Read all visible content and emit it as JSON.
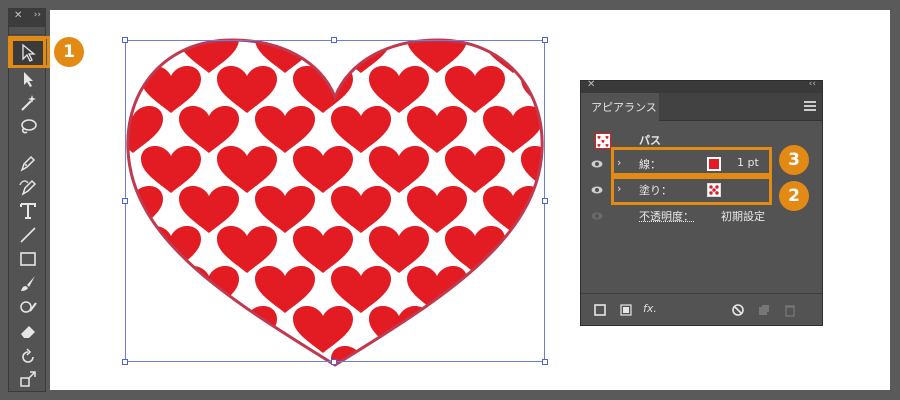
{
  "tools_panel": {
    "close_glyph": "✕",
    "collapse_glyph": "››",
    "tools": [
      {
        "name": "selection-tool",
        "icon": "selection-arrow-icon"
      },
      {
        "name": "direct-selection-tool",
        "icon": "direct-selection-arrow-icon"
      },
      {
        "name": "magic-wand-tool",
        "icon": "magic-wand-icon"
      },
      {
        "name": "lasso-tool",
        "icon": "lasso-icon"
      },
      {
        "name": "pen-tool",
        "icon": "pen-icon"
      },
      {
        "name": "curvature-tool",
        "icon": "curvature-icon"
      },
      {
        "name": "type-tool",
        "icon": "type-icon"
      },
      {
        "name": "line-tool",
        "icon": "line-icon"
      },
      {
        "name": "rectangle-tool",
        "icon": "rectangle-icon"
      },
      {
        "name": "paintbrush-tool",
        "icon": "brush-icon"
      },
      {
        "name": "shaper-tool",
        "icon": "shaper-icon"
      },
      {
        "name": "eraser-tool",
        "icon": "eraser-icon"
      },
      {
        "name": "rotate-tool",
        "icon": "rotate-icon"
      },
      {
        "name": "scale-tool",
        "icon": "scale-icon"
      }
    ]
  },
  "appearance_panel": {
    "close_glyph": "✕",
    "collapse_glyph": "‹‹",
    "tab_label": "アピアランス",
    "object_label": "パス",
    "rows": {
      "stroke": {
        "label": "線：",
        "value": "1 pt",
        "chevron": "›"
      },
      "fill": {
        "label": "塗り：",
        "chevron": "›"
      },
      "opacity": {
        "label": "不透明度：",
        "value": "初期設定"
      }
    },
    "footer": {
      "fx_label": "fx."
    }
  },
  "callouts": {
    "badge_1": "1",
    "badge_2": "2",
    "badge_3": "3"
  },
  "colors": {
    "accent": "#e38a15",
    "heart_red": "#e31b23",
    "heart_outline": "#c0394f",
    "selection": "#4b63d4"
  }
}
